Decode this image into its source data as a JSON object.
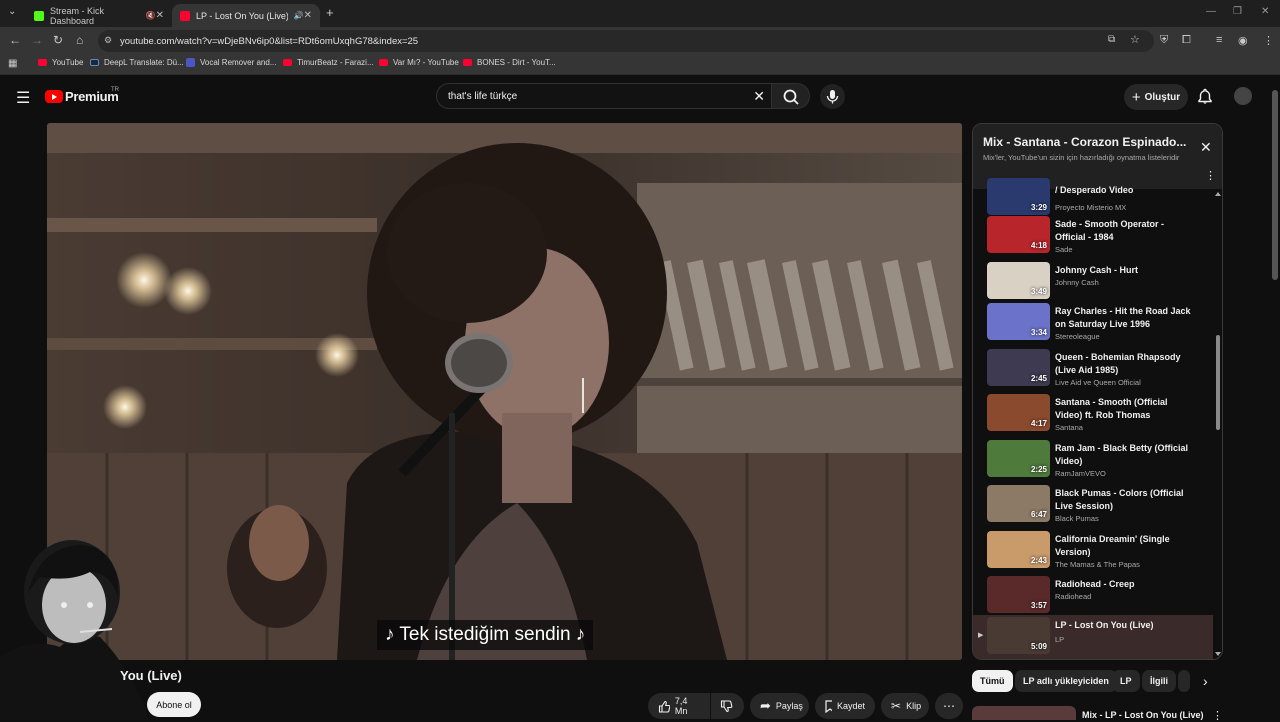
{
  "browser": {
    "tabs": [
      {
        "title": "Stream - Kick Dashboard",
        "color": "#53fc18"
      },
      {
        "title": "LP - Lost On You (Live) - Yo",
        "color": "#ff0033"
      }
    ],
    "url": "youtube.com/watch?v=wDjeBNv6ip0&list=RDt6omUxqhG78&index=25",
    "bookmarks": [
      {
        "label": "YouTube",
        "color": "#ff0033"
      },
      {
        "label": "DeepL Translate: Dü...",
        "color": "#0f2b46"
      },
      {
        "label": "Vocal Remover and...",
        "color": "#4a56c4"
      },
      {
        "label": "TimurBeatz - Farazi...",
        "color": "#ff0033"
      },
      {
        "label": "Var Mı? - YouTube",
        "color": "#ff0033"
      },
      {
        "label": "BONES - Dirt - YouT...",
        "color": "#ff0033"
      }
    ]
  },
  "header": {
    "logo": "Premium",
    "country": "TR",
    "search_value": "that's life türkçe",
    "create_label": "Oluştur"
  },
  "player": {
    "caption": "♪ Tek istediğim sendin ♪"
  },
  "video": {
    "title": "You (Live)",
    "subscribe_label": "Abone ol",
    "likes": "7,4 Mn",
    "share_label": "Paylaş",
    "save_label": "Kaydet",
    "clip_label": "Klip"
  },
  "playlist": {
    "title": "Mix - Santana - Corazon Espinado...",
    "subtitle": "Mix'ler, YouTube'un sizin için hazırladığı oynatma listeleridir",
    "items": [
      {
        "title": "/ Desperado Video",
        "channel": "Proyecto Misterio MX",
        "duration": "3:29",
        "thumb": "#2a3a6e"
      },
      {
        "title": "Sade - Smooth Operator - Official - 1984",
        "channel": "Sade",
        "duration": "4:18",
        "thumb": "#b8262b"
      },
      {
        "title": "Johnny Cash - Hurt",
        "channel": "Johnny Cash",
        "duration": "3:49",
        "thumb": "#d9d2c4"
      },
      {
        "title": "Ray Charles - Hit the Road Jack on Saturday Live 1996",
        "channel": "Stereoleague",
        "duration": "3:34",
        "thumb": "#6a72c9"
      },
      {
        "title": "Queen - Bohemian Rhapsody (Live Aid 1985)",
        "channel": "Live Aid ve Queen Official",
        "duration": "2:45",
        "thumb": "#3d3a52"
      },
      {
        "title": "Santana - Smooth (Official Video) ft. Rob Thomas",
        "channel": "Santana",
        "duration": "4:17",
        "thumb": "#8a4a2e"
      },
      {
        "title": "Ram Jam - Black Betty (Official Video)",
        "channel": "RamJamVEVO",
        "duration": "2:25",
        "thumb": "#4e7a3c"
      },
      {
        "title": "Black Pumas - Colors (Official Live Session)",
        "channel": "Black Pumas",
        "duration": "6:47",
        "thumb": "#8c7a66"
      },
      {
        "title": "California Dreamin' (Single Version)",
        "channel": "The Mamas & The Papas",
        "duration": "2:43",
        "thumb": "#c99a6a"
      },
      {
        "title": "Radiohead - Creep",
        "channel": "Radiohead",
        "duration": "3:57",
        "thumb": "#5a2a2a"
      },
      {
        "title": "LP - Lost On You (Live)",
        "channel": "LP",
        "duration": "5:09",
        "thumb": "#4a3a34",
        "current": true
      }
    ]
  },
  "chips": [
    "Tümü",
    "LP adlı yükleyiciden",
    "LP",
    "İlgili"
  ],
  "next_mix": "Mix - LP - Lost On You (Live)"
}
